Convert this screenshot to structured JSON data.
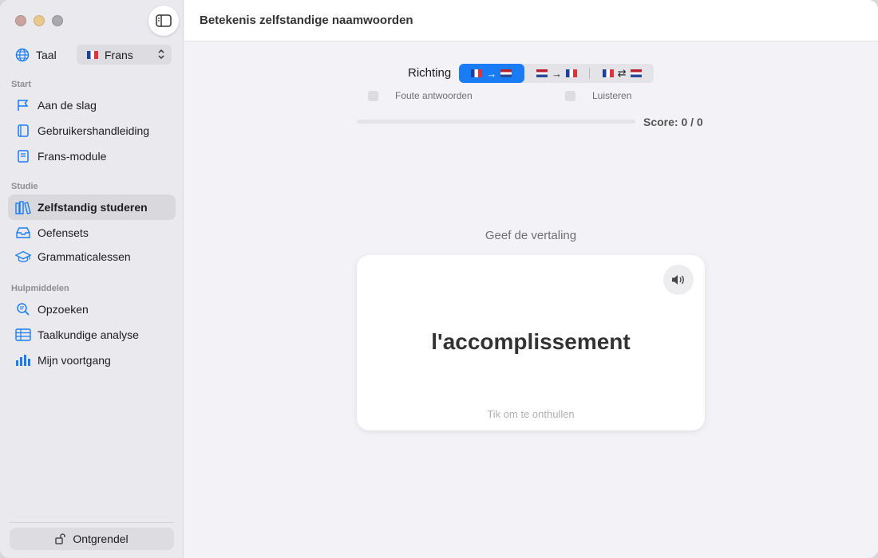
{
  "window": {
    "title": "Betekenis zelfstandige naamwoorden"
  },
  "sidebar": {
    "language": {
      "label": "Taal",
      "selected": "Frans",
      "icon": "globe-icon"
    },
    "sections": [
      {
        "title": "Start",
        "items": [
          {
            "label": "Aan de slag",
            "icon": "flag-icon"
          },
          {
            "label": "Gebruikershandleiding",
            "icon": "book-icon"
          },
          {
            "label": "Frans-module",
            "icon": "book-closed-icon"
          }
        ]
      },
      {
        "title": "Studie",
        "items": [
          {
            "label": "Zelfstandig studeren",
            "icon": "books-icon",
            "active": true
          },
          {
            "label": "Oefensets",
            "icon": "tray-icon"
          },
          {
            "label": "Grammaticalessen",
            "icon": "graduation-cap-icon"
          }
        ]
      },
      {
        "title": "Hulpmiddelen",
        "items": [
          {
            "label": "Opzoeken",
            "icon": "magnifier-icon"
          },
          {
            "label": "Taalkundige analyse",
            "icon": "table-icon"
          },
          {
            "label": "Mijn voortgang",
            "icon": "bar-chart-icon"
          }
        ]
      }
    ],
    "unlock_label": "Ontgrendel"
  },
  "practice": {
    "direction_label": "Richting",
    "directions": [
      {
        "from": "fr",
        "to": "nl",
        "symbol": "→",
        "selected": true
      },
      {
        "from": "nl",
        "to": "fr",
        "symbol": "→",
        "selected": false
      },
      {
        "from": "fr",
        "to": "nl",
        "symbol": "⇄",
        "selected": false
      }
    ],
    "options": [
      {
        "label": "Foute antwoorden",
        "checked": false
      },
      {
        "label": "Luisteren",
        "checked": false
      }
    ],
    "progress": 0,
    "score": "Score: 0 / 0",
    "prompt": "Geef de vertaling",
    "card": {
      "word": "l'accomplissement",
      "hint": "Tik om te onthullen"
    }
  },
  "colors": {
    "accent": "#1a7cf5",
    "sidebar_bg": "#e9e9ee",
    "main_bg": "#f2f2f7"
  }
}
